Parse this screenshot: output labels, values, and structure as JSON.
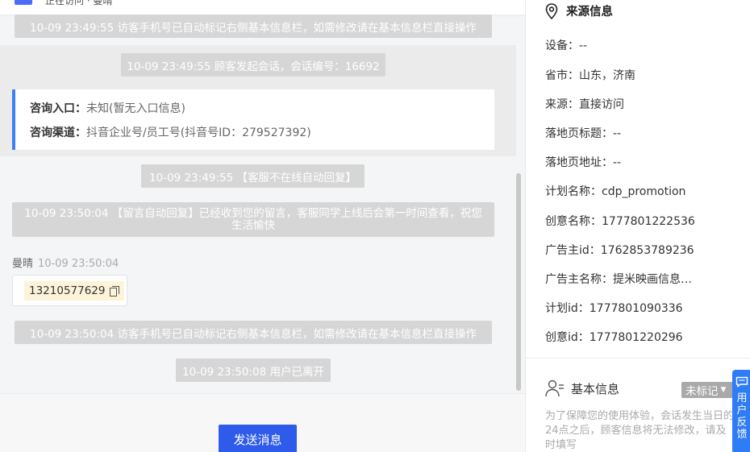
{
  "chat": {
    "header_text": "正在访问 · 曼晴",
    "system_messages": [
      "10-09 23:49:55 访客手机号已自动标记右侧基本信息栏，如需修改请在基本信息栏直接操作",
      "10-09 23:49:55 顾客发起会话，会话编号：16692",
      "10-09 23:49:55 【客服不在线自动回复】",
      "10-09 23:50:04 【留言自动回复】已经收到您的留言，客服同学上线后会第一时间查看，祝您生活愉快",
      "10-09 23:50:04 访客手机号已自动标记右侧基本信息栏，如需修改请在基本信息栏直接操作",
      "10-09 23:50:08 用户已离开"
    ],
    "consult_card": {
      "entry_label": "咨询入口：",
      "entry_value": "未知(暂无入口信息)",
      "channel_label": "咨询渠道：",
      "channel_value": "抖音企业号/员工号(抖音号ID：279527392)"
    },
    "agent_message": {
      "sender": "曼晴",
      "time": "10-09 23:50:04",
      "phone": "13210577629"
    },
    "send_label": "发送消息"
  },
  "info": {
    "source_title": "来源信息",
    "rows": [
      "设备：--",
      "省市：山东，济南",
      "来源：直接访问",
      "落地页标题：--",
      "落地页地址：--",
      "计划名称：cdp_promotion",
      "创意名称：1777801222536",
      "广告主id：1762853789236",
      "广告主名称：提米映画信息科技",
      "计划id：1777801090336",
      "创意id：1777801220296"
    ],
    "basic_title": "基本信息",
    "mark_label": "未标记",
    "basic_note": "为了保障您的使用体验，会话发生当日的24点之后，顾客信息将无法修改，请及时填写"
  },
  "feedback": {
    "label": "用户反馈"
  },
  "colors": {
    "accent": "#2f5bea",
    "card_border": "#3b82f6",
    "feedback": "#2e7cf6",
    "system_bg": "#d6d6d6"
  }
}
